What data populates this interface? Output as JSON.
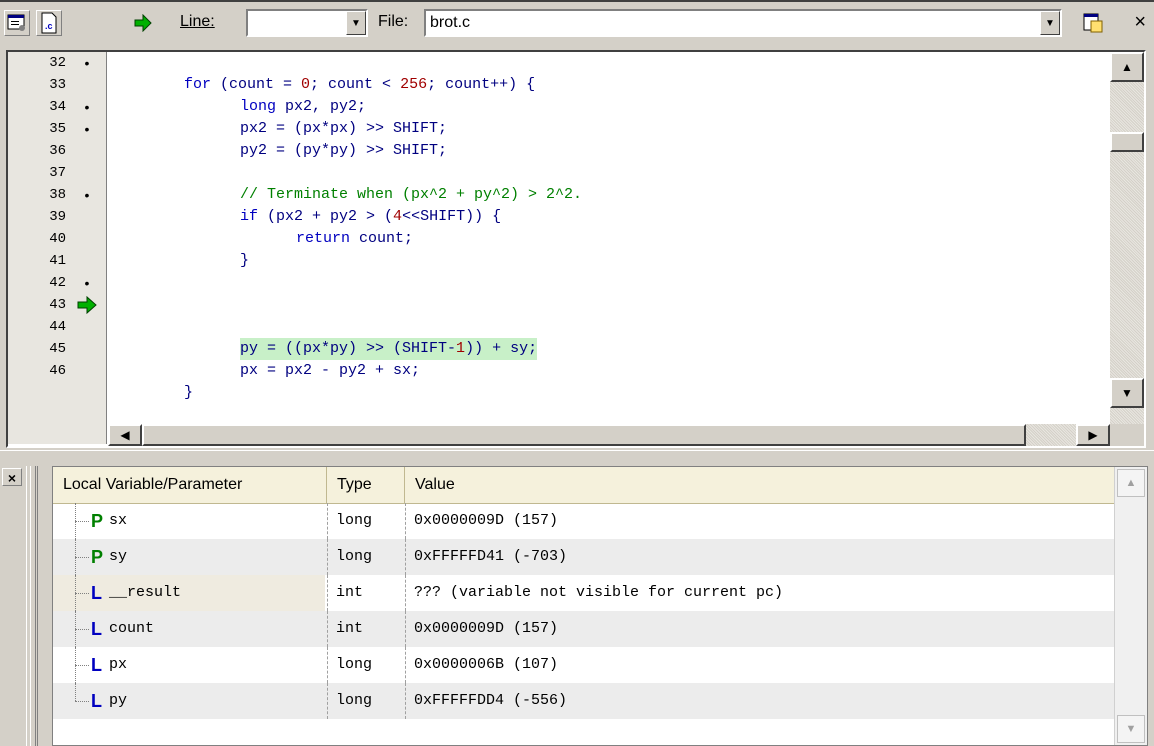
{
  "toolbar": {
    "line_label": "Line:",
    "line_value": "",
    "file_label": "File:",
    "file_value": "brot.c",
    "close": "×"
  },
  "editor": {
    "line_numbers": [
      "32",
      "33",
      "34",
      "35",
      "36",
      "37",
      "38",
      "39",
      "40",
      "41",
      "42",
      "43",
      "44",
      "45",
      "46"
    ],
    "gutter": [
      "•",
      "",
      "•",
      "•",
      "",
      "",
      "•",
      "",
      "",
      "",
      "•",
      "➜",
      "",
      "",
      ""
    ],
    "current_line": "43",
    "code": {
      "l33": {
        "kw1": "for",
        "t1": " (count = ",
        "n1": "0",
        "t2": "; count < ",
        "n2": "256",
        "t3": "; count++) {"
      },
      "l34": {
        "kw1": "long",
        "t1": " px2, py2;"
      },
      "l35": {
        "t1": "px2 = (px*px) >> SHIFT;"
      },
      "l36": {
        "t1": "py2 = (py*py) >> SHIFT;"
      },
      "l38": {
        "cm": "// Terminate when (px^2 + py^2) > 2^2."
      },
      "l39": {
        "kw1": "if",
        "t1": " (px2 + py2 > (",
        "n1": "4",
        "t2": "<<SHIFT)) {"
      },
      "l40": {
        "kw1": "return",
        "t1": " count;"
      },
      "l41": {
        "t1": "}"
      },
      "l43": {
        "t1": "py = ((px*py) >> (SHIFT-",
        "n1": "1",
        "t2": ")) + sy;"
      },
      "l44": {
        "t1": "px = px2 - py2 + sx;"
      },
      "l45": {
        "t1": "}"
      }
    }
  },
  "locals": {
    "headers": {
      "name": "Local Variable/Parameter",
      "type": "Type",
      "value": "Value"
    },
    "rows": [
      {
        "kind": "P",
        "name": "sx",
        "type": "long",
        "value": "0x0000009D (157)"
      },
      {
        "kind": "P",
        "name": "sy",
        "type": "long",
        "value": "0xFFFFFD41 (-703)"
      },
      {
        "kind": "L",
        "name": "__result",
        "type": "int",
        "value": "??? (variable not visible for current pc)"
      },
      {
        "kind": "L",
        "name": "count",
        "type": "int",
        "value": "0x0000009D (157)"
      },
      {
        "kind": "L",
        "name": "px",
        "type": "long",
        "value": "0x0000006B (107)"
      },
      {
        "kind": "L",
        "name": "py",
        "type": "long",
        "value": "0xFFFFFDD4 (-556)"
      }
    ]
  }
}
